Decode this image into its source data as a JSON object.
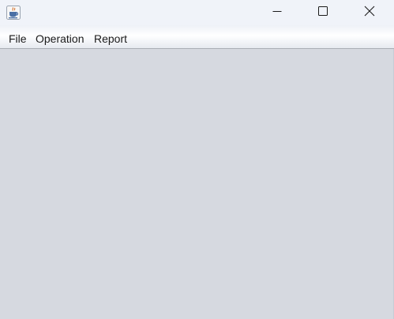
{
  "window": {
    "title": "",
    "app_icon": "java-coffee-cup-icon",
    "controls": {
      "minimize_icon": "minimize-icon",
      "maximize_icon": "maximize-icon",
      "close_icon": "close-icon"
    }
  },
  "menubar": {
    "items": [
      {
        "label": "File"
      },
      {
        "label": "Operation"
      },
      {
        "label": "Report"
      }
    ]
  },
  "colors": {
    "titlebar": "#f0f3f9",
    "content_background": "#d6d9e0",
    "menu_text": "#1a1a1a"
  }
}
